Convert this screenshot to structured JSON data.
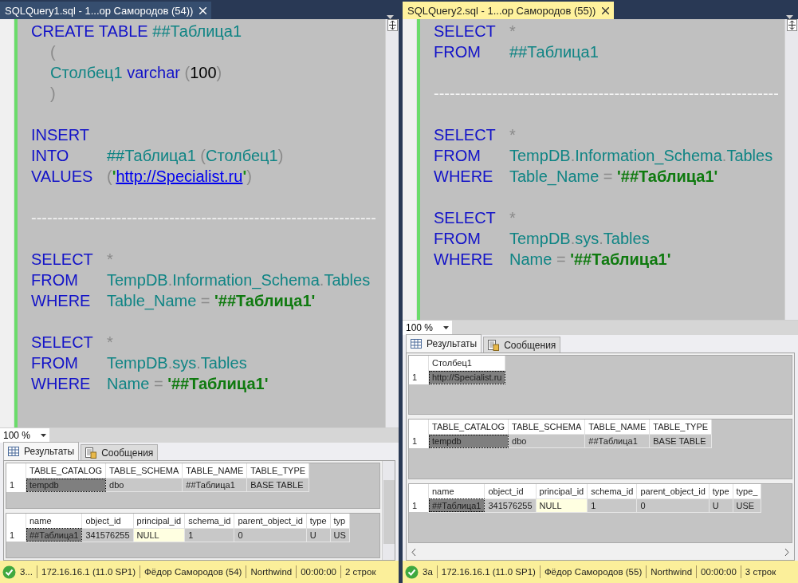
{
  "panes": [
    {
      "tab": {
        "title": "SQLQuery1.sql - 1...ор Самородов (54))",
        "active": false
      },
      "code": [
        [
          {
            "indented": false,
            "tokens": [
              {
                "text": "CREATE TABLE ",
                "kind": "kw"
              },
              {
                "text": "##Таблица1",
                "kind": "ident"
              }
            ]
          },
          {
            "indented": true,
            "tokens": [
              {
                "text": "(",
                "kind": "punc"
              }
            ]
          },
          {
            "indented": true,
            "tokens": [
              {
                "text": "Столбец1",
                "kind": "ident"
              },
              {
                "text": " varchar ",
                "kind": "kw"
              },
              {
                "text": "(",
                "kind": "punc"
              },
              {
                "text": "100",
                "kind": "num"
              },
              {
                "text": ")",
                "kind": "punc"
              }
            ]
          },
          {
            "indented": true,
            "tokens": [
              {
                "text": ")",
                "kind": "punc"
              }
            ]
          }
        ],
        [
          {
            "indented": false,
            "tokens": [
              {
                "text": "INSERT",
                "kind": "kw"
              }
            ]
          },
          {
            "indented": false,
            "tokens": [
              {
                "text": "INTO",
                "kind": "clause"
              },
              {
                "text": "##Таблица1 ",
                "kind": "ident"
              },
              {
                "text": "(",
                "kind": "punc"
              },
              {
                "text": "Столбец1",
                "kind": "ident"
              },
              {
                "text": ")",
                "kind": "punc"
              }
            ]
          },
          {
            "indented": false,
            "tokens": [
              {
                "text": "VALUES",
                "kind": "clause"
              },
              {
                "text": "(",
                "kind": "punc"
              },
              {
                "text": "'",
                "kind": "quote"
              },
              {
                "text": "http://Specialist.ru",
                "kind": "link"
              },
              {
                "text": "'",
                "kind": "quote"
              },
              {
                "text": ")",
                "kind": "punc"
              }
            ]
          }
        ],
        [
          {
            "indented": false,
            "tokens": [
              {
                "text": "-----------------------------------------------------------------",
                "kind": "comment"
              }
            ]
          }
        ],
        [
          {
            "indented": false,
            "tokens": [
              {
                "text": "SELECT",
                "kind": "clause"
              },
              {
                "text": "*",
                "kind": "punc"
              }
            ]
          },
          {
            "indented": false,
            "tokens": [
              {
                "text": "FROM",
                "kind": "clause"
              },
              {
                "text": "TempDB",
                "kind": "ident"
              },
              {
                "text": ".",
                "kind": "punc"
              },
              {
                "text": "Information_Schema",
                "kind": "ident"
              },
              {
                "text": ".",
                "kind": "punc"
              },
              {
                "text": "Tables",
                "kind": "ident"
              }
            ]
          },
          {
            "indented": false,
            "tokens": [
              {
                "text": "WHERE",
                "kind": "clause"
              },
              {
                "text": "Table_Name",
                "kind": "ident"
              },
              {
                "text": " = ",
                "kind": "punc"
              },
              {
                "text": "'##Таблица1'",
                "kind": "str"
              }
            ]
          }
        ],
        [
          {
            "indented": false,
            "tokens": [
              {
                "text": "SELECT",
                "kind": "clause"
              },
              {
                "text": "*",
                "kind": "punc"
              }
            ]
          },
          {
            "indented": false,
            "tokens": [
              {
                "text": "FROM",
                "kind": "clause"
              },
              {
                "text": "TempDB",
                "kind": "ident"
              },
              {
                "text": ".",
                "kind": "punc"
              },
              {
                "text": "sys",
                "kind": "ident"
              },
              {
                "text": ".",
                "kind": "punc"
              },
              {
                "text": "Tables",
                "kind": "ident"
              }
            ]
          },
          {
            "indented": false,
            "tokens": [
              {
                "text": "WHERE",
                "kind": "clause"
              },
              {
                "text": "Name",
                "kind": "ident"
              },
              {
                "text": " = ",
                "kind": "punc"
              },
              {
                "text": "'##Таблица1'",
                "kind": "str"
              }
            ]
          }
        ]
      ],
      "zoom": "100 %",
      "result_tabs": [
        {
          "label": "Результаты",
          "selected": true
        },
        {
          "label": "Сообщения",
          "selected": false
        }
      ],
      "grids": [
        {
          "columns": [
            "TABLE_CATALOG",
            "TABLE_SCHEMA",
            "TABLE_NAME",
            "TABLE_TYPE"
          ],
          "rows": [
            {
              "number": "1",
              "cells": [
                {
                  "text": "tempdb",
                  "kind": "value",
                  "selected": true
                },
                {
                  "text": "dbo",
                  "kind": "value",
                  "selected": false
                },
                {
                  "text": "##Таблица1",
                  "kind": "value",
                  "selected": false
                },
                {
                  "text": "BASE TABLE",
                  "kind": "value",
                  "selected": false
                }
              ]
            }
          ]
        },
        {
          "columns": [
            "name",
            "object_id",
            "principal_id",
            "schema_id",
            "parent_object_id",
            "type",
            "typ"
          ],
          "rows": [
            {
              "number": "1",
              "cells": [
                {
                  "text": "##Таблица1",
                  "kind": "value",
                  "selected": true
                },
                {
                  "text": "341576255",
                  "kind": "value",
                  "selected": false
                },
                {
                  "text": "NULL",
                  "kind": "null",
                  "selected": false
                },
                {
                  "text": "1",
                  "kind": "value",
                  "selected": false
                },
                {
                  "text": "0",
                  "kind": "value",
                  "selected": false
                },
                {
                  "text": "U",
                  "kind": "value",
                  "selected": false
                },
                {
                  "text": "US",
                  "kind": "value",
                  "selected": false
                }
              ]
            }
          ]
        }
      ],
      "status": {
        "state": "3...",
        "items": [
          "172.16.16.1 (11.0 SP1)",
          "Фёдор Самородов (54)",
          "Northwind",
          "00:00:00",
          "2 строк"
        ]
      }
    },
    {
      "tab": {
        "title": "SQLQuery2.sql - 1...ор Самородов (55))",
        "active": true
      },
      "code": [
        [
          {
            "indented": false,
            "tokens": [
              {
                "text": "SELECT",
                "kind": "clause"
              },
              {
                "text": "*",
                "kind": "punc"
              }
            ]
          },
          {
            "indented": false,
            "tokens": [
              {
                "text": "FROM",
                "kind": "clause"
              },
              {
                "text": "##Таблица1",
                "kind": "ident"
              }
            ]
          }
        ],
        [
          {
            "indented": false,
            "tokens": [
              {
                "text": "-----------------------------------------------------------------",
                "kind": "comment"
              }
            ]
          }
        ],
        [
          {
            "indented": false,
            "tokens": [
              {
                "text": "SELECT",
                "kind": "clause"
              },
              {
                "text": "*",
                "kind": "punc"
              }
            ]
          },
          {
            "indented": false,
            "tokens": [
              {
                "text": "FROM",
                "kind": "clause"
              },
              {
                "text": "TempDB",
                "kind": "ident"
              },
              {
                "text": ".",
                "kind": "punc"
              },
              {
                "text": "Information_Schema",
                "kind": "ident"
              },
              {
                "text": ".",
                "kind": "punc"
              },
              {
                "text": "Tables",
                "kind": "ident"
              }
            ]
          },
          {
            "indented": false,
            "tokens": [
              {
                "text": "WHERE",
                "kind": "clause"
              },
              {
                "text": "Table_Name",
                "kind": "ident"
              },
              {
                "text": " = ",
                "kind": "punc"
              },
              {
                "text": "'##Таблица1'",
                "kind": "str"
              }
            ]
          }
        ],
        [
          {
            "indented": false,
            "tokens": [
              {
                "text": "SELECT",
                "kind": "clause"
              },
              {
                "text": "*",
                "kind": "punc"
              }
            ]
          },
          {
            "indented": false,
            "tokens": [
              {
                "text": "FROM",
                "kind": "clause"
              },
              {
                "text": "TempDB",
                "kind": "ident"
              },
              {
                "text": ".",
                "kind": "punc"
              },
              {
                "text": "sys",
                "kind": "ident"
              },
              {
                "text": ".",
                "kind": "punc"
              },
              {
                "text": "Tables",
                "kind": "ident"
              }
            ]
          },
          {
            "indented": false,
            "tokens": [
              {
                "text": "WHERE",
                "kind": "clause"
              },
              {
                "text": "Name",
                "kind": "ident"
              },
              {
                "text": " = ",
                "kind": "punc"
              },
              {
                "text": "'##Таблица1'",
                "kind": "str"
              }
            ]
          }
        ]
      ],
      "zoom": "100 %",
      "result_tabs": [
        {
          "label": "Результаты",
          "selected": true
        },
        {
          "label": "Сообщения",
          "selected": false
        }
      ],
      "grids": [
        {
          "columns": [
            "Столбец1"
          ],
          "rows": [
            {
              "number": "1",
              "cells": [
                {
                  "text": "http://Specialist.ru",
                  "kind": "value",
                  "selected": true
                }
              ]
            }
          ]
        },
        {
          "columns": [
            "TABLE_CATALOG",
            "TABLE_SCHEMA",
            "TABLE_NAME",
            "TABLE_TYPE"
          ],
          "rows": [
            {
              "number": "1",
              "cells": [
                {
                  "text": "tempdb",
                  "kind": "value",
                  "selected": true
                },
                {
                  "text": "dbo",
                  "kind": "value",
                  "selected": false
                },
                {
                  "text": "##Таблица1",
                  "kind": "value",
                  "selected": false
                },
                {
                  "text": "BASE TABLE",
                  "kind": "value",
                  "selected": false
                }
              ]
            }
          ]
        },
        {
          "columns": [
            "name",
            "object_id",
            "principal_id",
            "schema_id",
            "parent_object_id",
            "type",
            "type_"
          ],
          "rows": [
            {
              "number": "1",
              "cells": [
                {
                  "text": "##Таблица1",
                  "kind": "value",
                  "selected": true
                },
                {
                  "text": "341576255",
                  "kind": "value",
                  "selected": false
                },
                {
                  "text": "NULL",
                  "kind": "null",
                  "selected": false
                },
                {
                  "text": "1",
                  "kind": "value",
                  "selected": false
                },
                {
                  "text": "0",
                  "kind": "value",
                  "selected": false
                },
                {
                  "text": "U",
                  "kind": "value",
                  "selected": false
                },
                {
                  "text": "USE",
                  "kind": "value",
                  "selected": false
                }
              ]
            }
          ]
        }
      ],
      "status": {
        "state": "3а",
        "items": [
          "172.16.16.1 (11.0 SP1)",
          "Фёдор Самородов (55)",
          "Northwind",
          "00:00:00",
          "3 строк"
        ]
      }
    }
  ]
}
